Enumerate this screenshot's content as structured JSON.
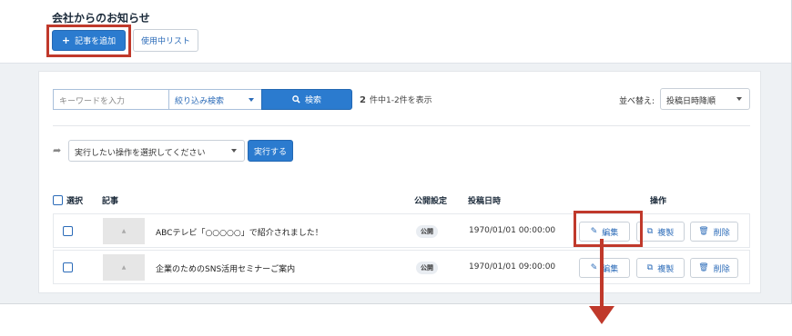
{
  "header": {
    "title": "会社からのお知らせ",
    "add_label": "記事を追加",
    "list_label": "使用中リスト"
  },
  "search": {
    "placeholder": "キーワードを入力",
    "filter_label": "絞り込み検索",
    "button_label": "検索",
    "count_number": "2",
    "count_text": "件中1-2件を表示",
    "sort_label": "並べ替え:",
    "sort_value": "投稿日時降順"
  },
  "bulk": {
    "select_label": "実行したい操作を選択してください",
    "run_label": "実行する"
  },
  "table": {
    "headers": {
      "select": "選択",
      "article": "記事",
      "public": "公開設定",
      "date": "投稿日時",
      "actions": "操作"
    },
    "rows": [
      {
        "title": "ABCテレビ「○○○○○」で紹介されました！",
        "status": "公開",
        "date": "1970/01/01 00:00:00",
        "edit": "編集",
        "copy": "複製",
        "delete": "削除"
      },
      {
        "title": "企業のためのSNS活用セミナーご案内",
        "status": "公開",
        "date": "1970/01/01 09:00:00",
        "edit": "編集",
        "copy": "複製",
        "delete": "削除"
      }
    ]
  },
  "annotation": {
    "highlight_color": "#c0392b"
  },
  "colors": {
    "primary": "#2b7bcf",
    "link": "#2b6bb8"
  }
}
